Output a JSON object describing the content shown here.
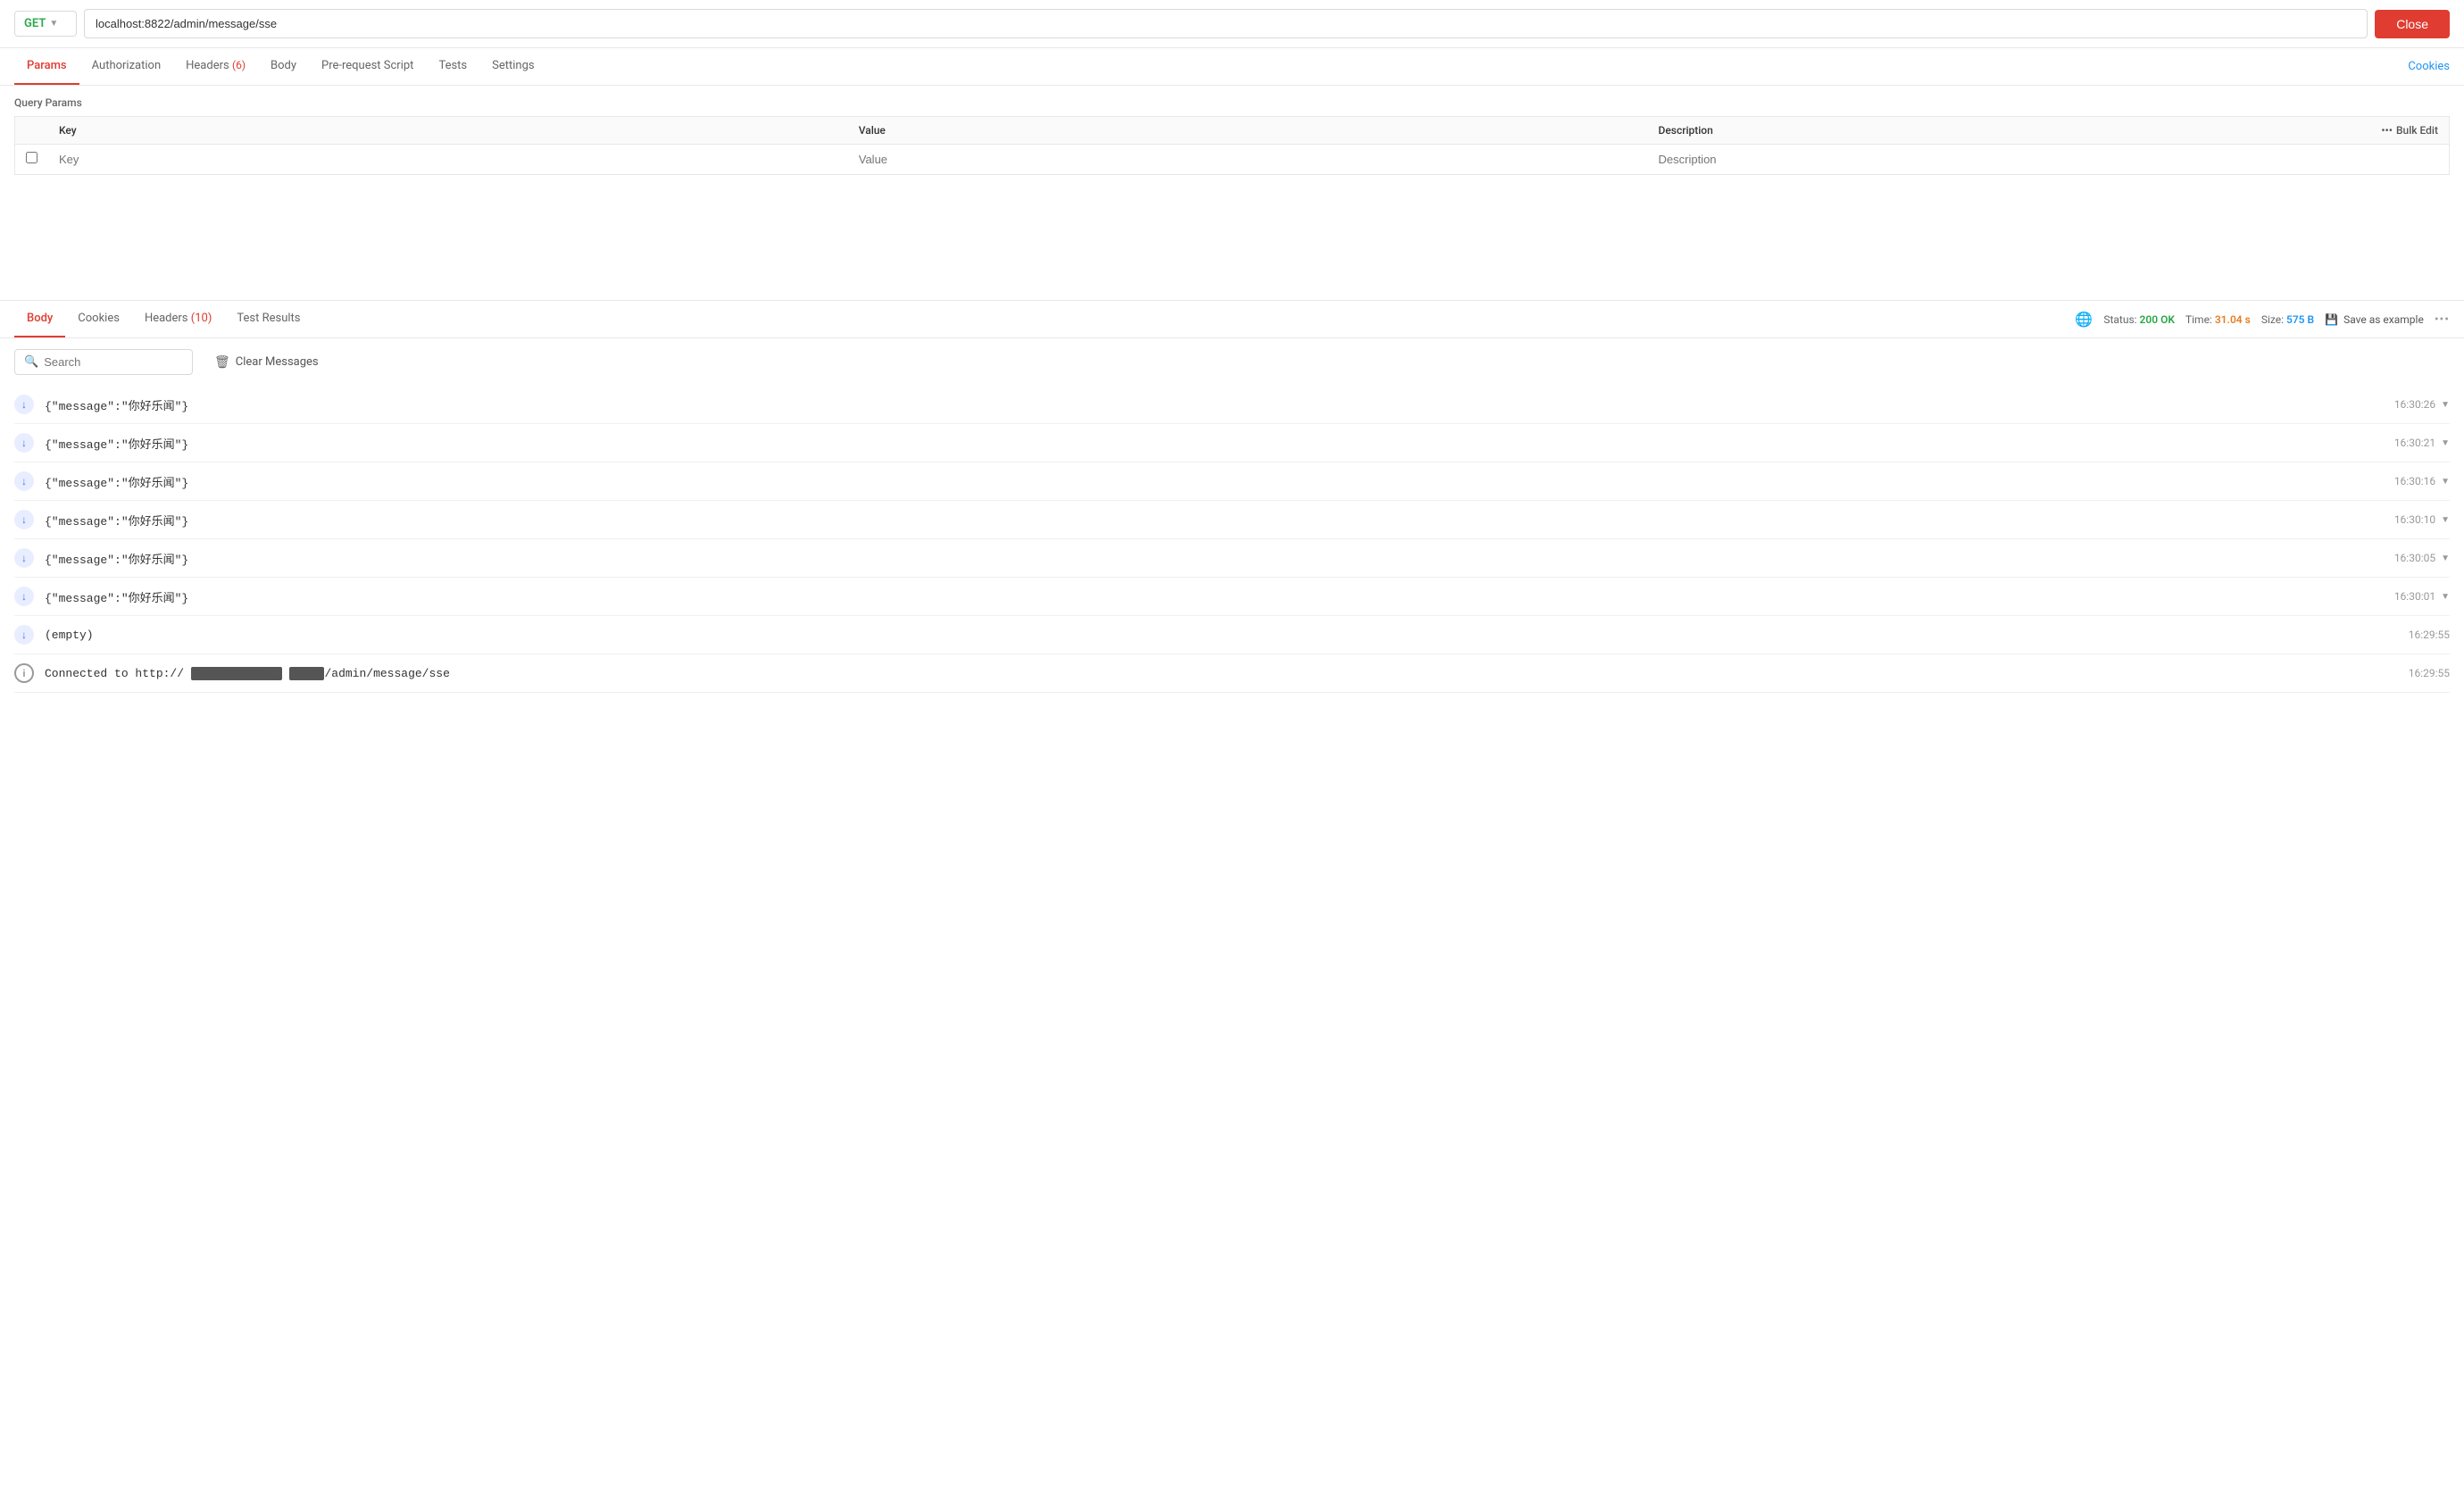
{
  "urlBar": {
    "method": "GET",
    "url": "localhost:8822/admin/message/sse",
    "closeLabel": "Close"
  },
  "topTabs": [
    {
      "id": "params",
      "label": "Params",
      "active": true,
      "badge": null
    },
    {
      "id": "authorization",
      "label": "Authorization",
      "active": false,
      "badge": null
    },
    {
      "id": "headers",
      "label": "Headers",
      "active": false,
      "badge": "6"
    },
    {
      "id": "body",
      "label": "Body",
      "active": false,
      "badge": null
    },
    {
      "id": "prerequest",
      "label": "Pre-request Script",
      "active": false,
      "badge": null
    },
    {
      "id": "tests",
      "label": "Tests",
      "active": false,
      "badge": null
    },
    {
      "id": "settings",
      "label": "Settings",
      "active": false,
      "badge": null
    }
  ],
  "cookiesLink": "Cookies",
  "queryParams": {
    "label": "Query Params",
    "columns": [
      "Key",
      "Value",
      "Description"
    ],
    "bulkEditLabel": "Bulk Edit",
    "placeholder": {
      "key": "Key",
      "value": "Value",
      "description": "Description"
    }
  },
  "bottomTabs": [
    {
      "id": "body",
      "label": "Body",
      "active": true,
      "badge": null
    },
    {
      "id": "cookies",
      "label": "Cookies",
      "active": false,
      "badge": null
    },
    {
      "id": "headers",
      "label": "Headers",
      "active": false,
      "badge": "10"
    },
    {
      "id": "testresults",
      "label": "Test Results",
      "active": false,
      "badge": null
    }
  ],
  "statusBar": {
    "statusLabel": "Status:",
    "statusValue": "200 OK",
    "timeLabel": "Time:",
    "timeValue": "31.04 s",
    "sizeLabel": "Size:",
    "sizeValue": "575 B",
    "saveExampleLabel": "Save as example"
  },
  "searchPlaceholder": "Search",
  "clearMessagesLabel": "Clear Messages",
  "messages": [
    {
      "type": "down",
      "content": "{\"message\":\"你好乐闻\"}",
      "time": "16:30:26",
      "expandable": true
    },
    {
      "type": "down",
      "content": "{\"message\":\"你好乐闻\"}",
      "time": "16:30:21",
      "expandable": true
    },
    {
      "type": "down",
      "content": "{\"message\":\"你好乐闻\"}",
      "time": "16:30:16",
      "expandable": true
    },
    {
      "type": "down",
      "content": "{\"message\":\"你好乐闻\"}",
      "time": "16:30:10",
      "expandable": true
    },
    {
      "type": "down",
      "content": "{\"message\":\"你好乐闻\"}",
      "time": "16:30:05",
      "expandable": true
    },
    {
      "type": "down",
      "content": "{\"message\":\"你好乐闻\"}",
      "time": "16:30:01",
      "expandable": true
    },
    {
      "type": "down",
      "content": "(empty)",
      "time": "16:29:55",
      "expandable": false
    },
    {
      "type": "info",
      "content": "Connected to http://",
      "time": "16:29:55",
      "expandable": false,
      "redacted": "/admin/message/sse"
    }
  ]
}
